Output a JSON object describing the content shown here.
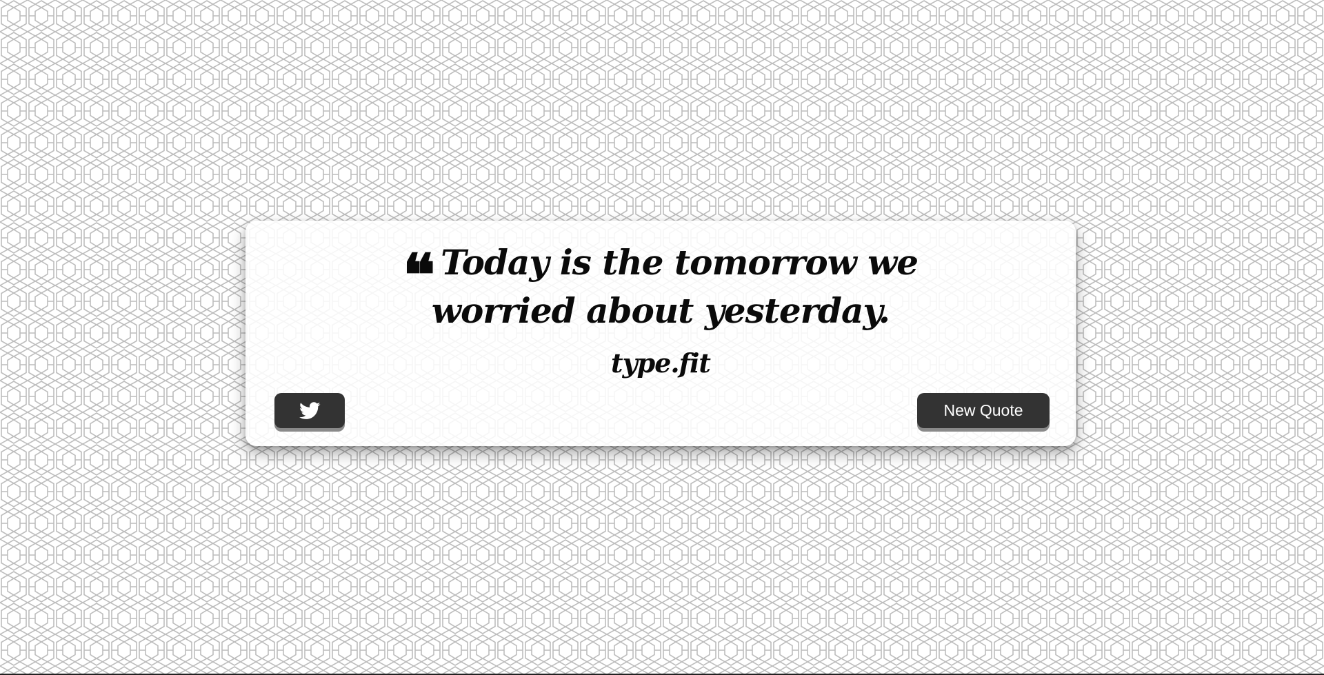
{
  "quote": {
    "quote_mark": "❝",
    "text": "Today is the tomorrow we worried about yesterday.",
    "author": "type.fit"
  },
  "buttons": {
    "tweet_icon": "twitter-icon",
    "new_quote_label": "New Quote"
  },
  "colors": {
    "button_bg": "#333333",
    "button_text": "#ffffff",
    "text": "#0a0a0a"
  }
}
